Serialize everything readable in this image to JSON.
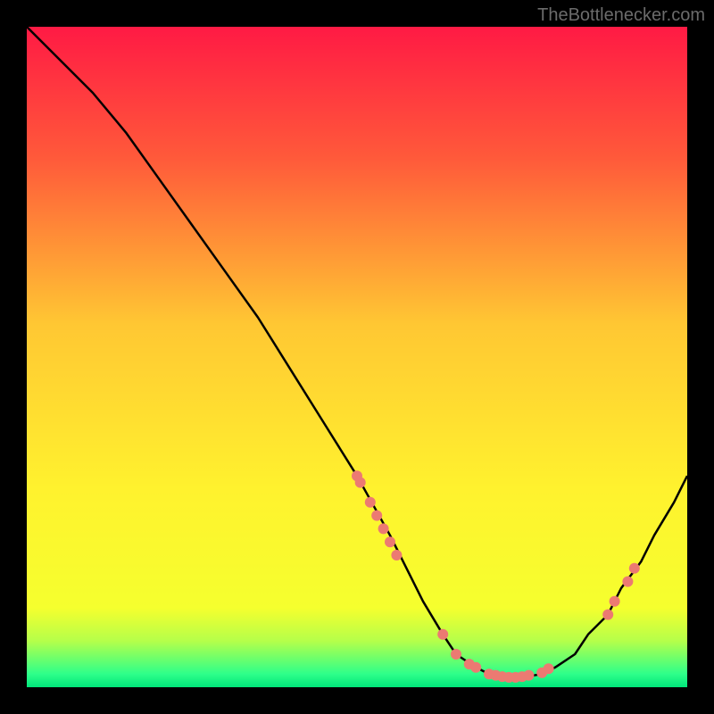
{
  "watermark": "TheBottlenecker.com",
  "chart_data": {
    "type": "line",
    "title": "",
    "xlabel": "",
    "ylabel": "",
    "xlim": [
      0,
      100
    ],
    "ylim": [
      0,
      100
    ],
    "background_gradient": {
      "stops": [
        {
          "offset": 0,
          "color": "#ff1a44"
        },
        {
          "offset": 20,
          "color": "#ff5a3a"
        },
        {
          "offset": 45,
          "color": "#ffc733"
        },
        {
          "offset": 70,
          "color": "#fff22e"
        },
        {
          "offset": 88,
          "color": "#f5ff2e"
        },
        {
          "offset": 93,
          "color": "#b5ff4a"
        },
        {
          "offset": 98,
          "color": "#2eff8a"
        },
        {
          "offset": 100,
          "color": "#00e57a"
        }
      ]
    },
    "series": [
      {
        "name": "bottleneck-curve",
        "type": "line",
        "x": [
          0,
          5,
          10,
          15,
          20,
          25,
          30,
          35,
          40,
          45,
          50,
          55,
          58,
          60,
          63,
          65,
          68,
          70,
          73,
          75,
          78,
          80,
          83,
          85,
          88,
          90,
          93,
          95,
          98,
          100
        ],
        "y": [
          100,
          95,
          90,
          84,
          77,
          70,
          63,
          56,
          48,
          40,
          32,
          23,
          17,
          13,
          8,
          5,
          3,
          2,
          1.5,
          1.5,
          2,
          3,
          5,
          8,
          11,
          15,
          19,
          23,
          28,
          32
        ],
        "color": "#000000"
      },
      {
        "name": "gpu-points",
        "type": "scatter",
        "x": [
          50,
          50.5,
          52,
          53,
          54,
          55,
          56,
          63,
          65,
          67,
          68,
          70,
          71,
          72,
          73,
          74,
          75,
          76,
          78,
          79,
          88,
          89,
          91,
          92
        ],
        "y": [
          32,
          31,
          28,
          26,
          24,
          22,
          20,
          8,
          5,
          3.5,
          3,
          2,
          1.8,
          1.6,
          1.5,
          1.5,
          1.6,
          1.8,
          2.2,
          2.8,
          11,
          13,
          16,
          18
        ],
        "color": "#ec7a72"
      }
    ]
  }
}
